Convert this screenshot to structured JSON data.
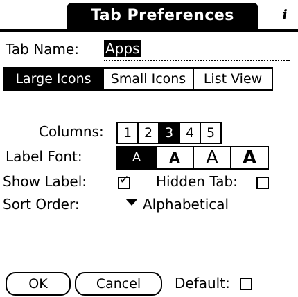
{
  "title": "Tab Preferences",
  "info_icon": "info-icon",
  "tab_name": {
    "label": "Tab Name:",
    "value": "Apps"
  },
  "view_modes": [
    {
      "label": "Large Icons",
      "selected": true
    },
    {
      "label": "Small Icons",
      "selected": false
    },
    {
      "label": "List View",
      "selected": false
    }
  ],
  "columns": {
    "label": "Columns:",
    "options": [
      "1",
      "2",
      "3",
      "4",
      "5"
    ],
    "selected": "3"
  },
  "label_font": {
    "label": "Label Font:",
    "options": [
      "A",
      "A",
      "A",
      "A"
    ],
    "selected_index": 0
  },
  "show_label": {
    "label": "Show Label:",
    "checked": true,
    "check_glyph": "🗸"
  },
  "hidden_tab": {
    "label": "Hidden Tab:",
    "checked": false
  },
  "sort_order": {
    "label": "Sort Order:",
    "value": "Alphabetical"
  },
  "buttons": {
    "ok": "OK",
    "cancel": "Cancel"
  },
  "default": {
    "label": "Default:",
    "checked": false
  }
}
